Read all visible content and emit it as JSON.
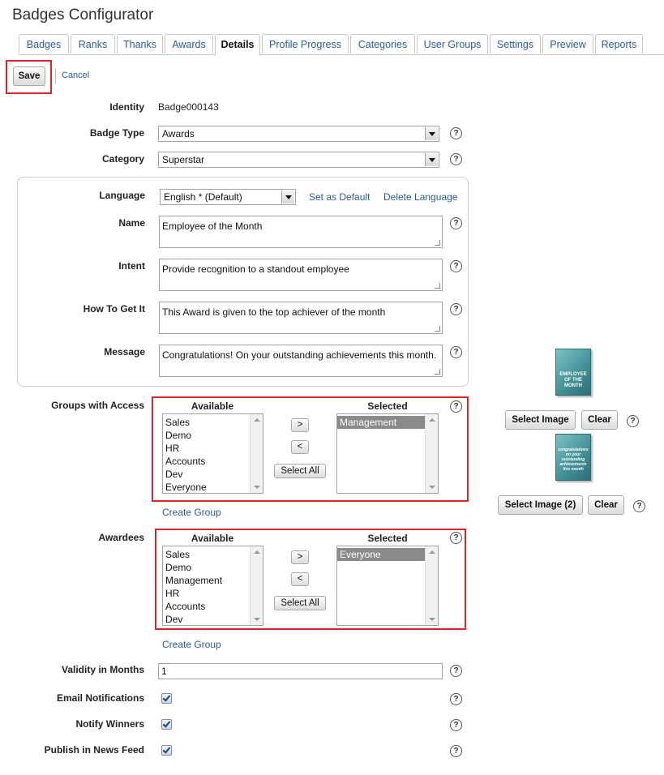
{
  "title": "Badges Configurator",
  "tabs": [
    "Badges",
    "Ranks",
    "Thanks",
    "Awards",
    "Details",
    "Profile Progress",
    "Categories",
    "User Groups",
    "Settings",
    "Preview",
    "Reports"
  ],
  "active_tab": "Details",
  "actions": {
    "save": "Save",
    "cancel": "Cancel"
  },
  "identity": {
    "label": "Identity",
    "value": "Badge000143"
  },
  "badge_type": {
    "label": "Badge Type",
    "value": "Awards"
  },
  "category": {
    "label": "Category",
    "value": "Superstar"
  },
  "language": {
    "label": "Language",
    "value": "English * (Default)",
    "set_default": "Set as Default",
    "delete": "Delete Language"
  },
  "name": {
    "label": "Name",
    "value": "Employee of the Month"
  },
  "intent": {
    "label": "Intent",
    "value": "Provide recognition to a standout employee"
  },
  "how_to_get": {
    "label": "How To Get It",
    "value": "This Award is given to the top achiever of the month"
  },
  "message": {
    "label": "Message",
    "value": "Congratulations! On your outstanding achievements this month."
  },
  "groups_access": {
    "label": "Groups with Access",
    "available_label": "Available",
    "selected_label": "Selected",
    "available": [
      "Sales",
      "Demo",
      "HR",
      "Accounts",
      "Dev",
      "Everyone"
    ],
    "selected": [
      "Management"
    ],
    "add": ">",
    "remove": "<",
    "select_all": "Select All",
    "create_group": "Create Group"
  },
  "awardees": {
    "label": "Awardees",
    "available_label": "Available",
    "selected_label": "Selected",
    "available": [
      "Sales",
      "Demo",
      "Management",
      "HR",
      "Accounts",
      "Dev"
    ],
    "selected": [
      "Everyone"
    ],
    "add": ">",
    "remove": "<",
    "select_all": "Select All",
    "create_group": "Create Group"
  },
  "image1": {
    "caption": "EMPLOYEE OF THE MONTH",
    "select": "Select Image",
    "clear": "Clear"
  },
  "image2": {
    "caption": "congratulations on your outstanding achievements this month",
    "select": "Select Image (2)",
    "clear": "Clear"
  },
  "validity": {
    "label": "Validity in Months",
    "value": "1"
  },
  "email_notifications": {
    "label": "Email Notifications",
    "checked": true
  },
  "notify_winners": {
    "label": "Notify Winners",
    "checked": true
  },
  "publish_news": {
    "label": "Publish in News Feed",
    "checked": true
  },
  "help_glyph": "?",
  "colors": {
    "link": "#2a5d96",
    "highlight_box": "#d9262b",
    "selected_option": "#8a8a8a"
  }
}
